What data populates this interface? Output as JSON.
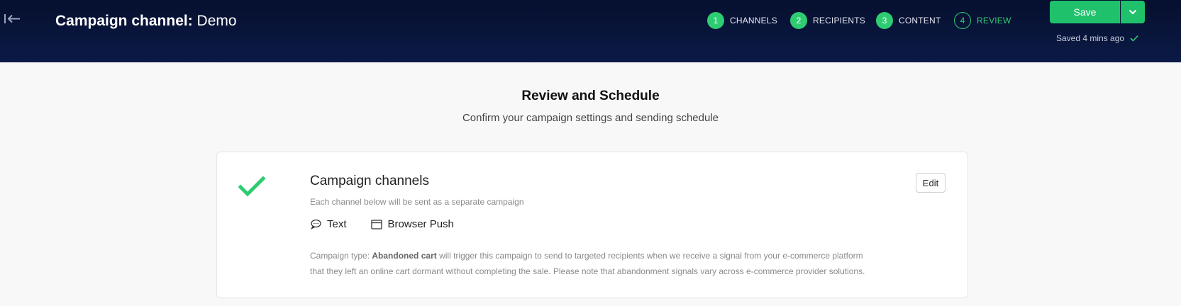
{
  "header": {
    "title_prefix": "Campaign channel:",
    "title_name": "Demo",
    "steps": [
      {
        "num": "1",
        "label": "CHANNELS"
      },
      {
        "num": "2",
        "label": "RECIPIENTS"
      },
      {
        "num": "3",
        "label": "CONTENT"
      },
      {
        "num": "4",
        "label": "REVIEW"
      }
    ],
    "save_label": "Save",
    "saved_status": "Saved 4 mins ago"
  },
  "page": {
    "heading": "Review and Schedule",
    "subheading": "Confirm your campaign settings and sending schedule"
  },
  "card": {
    "title": "Campaign channels",
    "subtitle": "Each channel below will be sent as a separate campaign",
    "edit_label": "Edit",
    "channels": [
      {
        "label": "Text",
        "icon": "chat-bubble-icon"
      },
      {
        "label": "Browser Push",
        "icon": "browser-window-icon"
      }
    ],
    "desc_prefix": "Campaign type:",
    "desc_type": "Abandoned cart",
    "desc_line1": "will trigger this campaign to send to targeted recipients when we receive a signal from your e-commerce platform",
    "desc_line2": "that they left an online cart dormant without completing the sale. Please note that abandonment signals vary across e-commerce provider solutions."
  },
  "colors": {
    "header_bg": "#0b1a46",
    "accent_green": "#1fc16b"
  }
}
